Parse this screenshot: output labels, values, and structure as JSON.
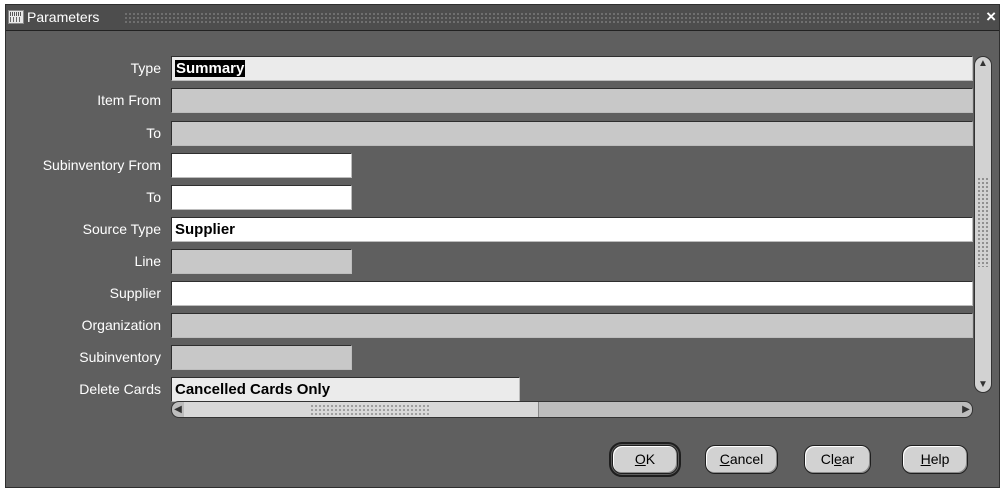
{
  "window": {
    "title": "Parameters",
    "close_symbol": "×"
  },
  "form": {
    "fields": [
      {
        "label": "Type",
        "value": "Summary",
        "state": "selected"
      },
      {
        "label": "Item From",
        "value": "",
        "state": "disabled"
      },
      {
        "label": "To",
        "value": "",
        "state": "disabled"
      },
      {
        "label": "Subinventory From",
        "value": "",
        "state": "enabled"
      },
      {
        "label": "To",
        "value": "",
        "state": "enabled"
      },
      {
        "label": "Source Type",
        "value": "Supplier",
        "state": "enabled"
      },
      {
        "label": "Line",
        "value": "",
        "state": "disabled"
      },
      {
        "label": "Supplier",
        "value": "",
        "state": "enabled"
      },
      {
        "label": "Organization",
        "value": "",
        "state": "disabled"
      },
      {
        "label": "Subinventory",
        "value": "",
        "state": "disabled"
      },
      {
        "label": "Delete Cards",
        "value": "Cancelled Cards Only",
        "state": "enabled"
      }
    ]
  },
  "buttons": {
    "ok": {
      "mnemonic": "O",
      "rest": "K"
    },
    "cancel": {
      "mnemonic": "C",
      "rest": "ancel"
    },
    "clear": {
      "pre": "Cl",
      "mnemonic": "e",
      "rest": "ar"
    },
    "help": {
      "mnemonic": "H",
      "rest": "elp"
    }
  },
  "icons": {
    "close": "close-icon",
    "scroll_up": "▲",
    "scroll_down": "▼",
    "scroll_left": "◀",
    "scroll_right": "▶"
  },
  "colors": {
    "window_bg": "#5f5f5f",
    "enabled_field": "#ffffff",
    "disabled_field": "#c8c8c8"
  }
}
